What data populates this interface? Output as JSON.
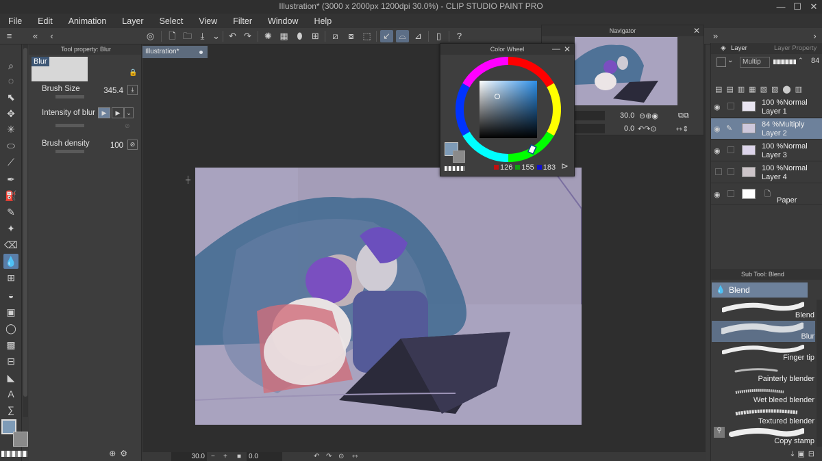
{
  "window": {
    "title": "Illustration* (3000 x 2000px 1200dpi 30.0%) - CLIP STUDIO PAINT PRO",
    "controls": [
      "—",
      "☐",
      "✕"
    ]
  },
  "menu": [
    "File",
    "Edit",
    "Animation",
    "Layer",
    "Select",
    "View",
    "Filter",
    "Window",
    "Help"
  ],
  "tool_property": {
    "title": "Tool property: Blur",
    "preset_name": "Blur",
    "brush_size_label": "Brush Size",
    "brush_size_value": "345.4",
    "intensity_label": "Intensity of blur",
    "density_label": "Brush density",
    "density_value": "100"
  },
  "document": {
    "tab_label": "Illustration*"
  },
  "navigator": {
    "title": "Navigator",
    "zoom_value": "30.0",
    "rotation_value": "0.0"
  },
  "color_wheel": {
    "title": "Color Wheel",
    "r": "126",
    "g": "155",
    "b": "183",
    "main_color": "#7e9bb7",
    "sub_color": "#8a8a8a"
  },
  "layer_panel": {
    "tab_layer": "Layer",
    "tab_property": "Layer Property",
    "blend_mode": "Multip",
    "opacity": "84",
    "layers": [
      {
        "line1": "100 %Normal",
        "line2": "Layer 1",
        "visible": true,
        "selected": false
      },
      {
        "line1": "84 %Multiply",
        "line2": "Layer 2",
        "visible": true,
        "selected": true
      },
      {
        "line1": "100 %Normal",
        "line2": "Layer 3",
        "visible": true,
        "selected": false
      },
      {
        "line1": "100 %Normal",
        "line2": "Layer 4",
        "visible": false,
        "selected": false
      },
      {
        "line1": "",
        "line2": "Paper",
        "visible": true,
        "selected": false
      }
    ]
  },
  "sub_tool": {
    "title": "Sub Tool: Blend",
    "group": "Blend",
    "brushes": [
      "Blend",
      "Blur",
      "Finger tip",
      "Painterly blender",
      "Wet bleed blender",
      "Textured blender",
      "Copy stamp"
    ],
    "selected": "Blur"
  },
  "status": {
    "zoom": "30.0",
    "rotation": "0.0"
  }
}
